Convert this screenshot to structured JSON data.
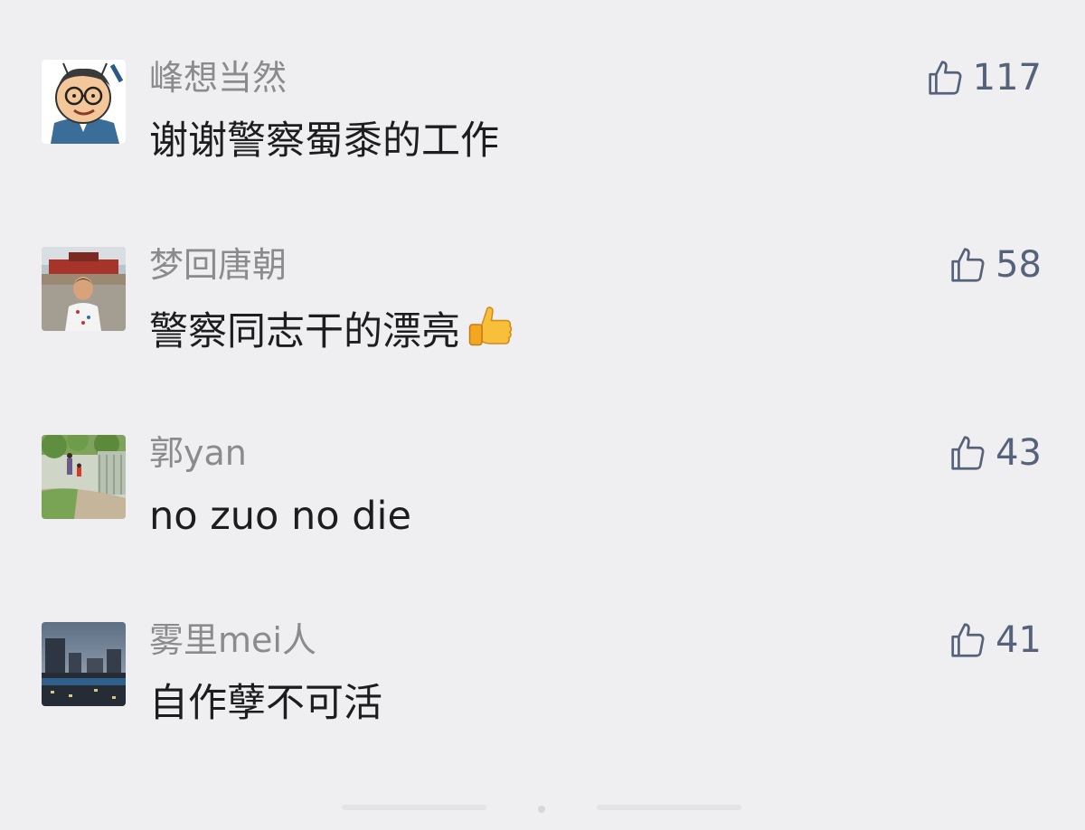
{
  "comments": [
    {
      "nickname": "峰想当然",
      "content": "谢谢警察蜀黍的工作",
      "likes": "117",
      "avatar": "cartoon-man-glasses",
      "has_thumb_emoji": false
    },
    {
      "nickname": "梦回唐朝",
      "content": "警察同志干的漂亮",
      "likes": "58",
      "avatar": "child-tiananmen-photo",
      "has_thumb_emoji": true
    },
    {
      "nickname": "郭yan",
      "content": "no zuo no die",
      "likes": "43",
      "avatar": "park-path-photo",
      "has_thumb_emoji": false
    },
    {
      "nickname": "雾里mei人",
      "content": "自作孽不可活",
      "likes": "41",
      "avatar": "city-dusk-photo",
      "has_thumb_emoji": false
    }
  ],
  "icons": {
    "like": "thumbs-up-outline-icon",
    "emoji": "thumbs-up-emoji"
  },
  "colors": {
    "background": "#efeff1",
    "nickname": "#8b8b8e",
    "content": "#1d1d1f",
    "like": "#56627a"
  }
}
